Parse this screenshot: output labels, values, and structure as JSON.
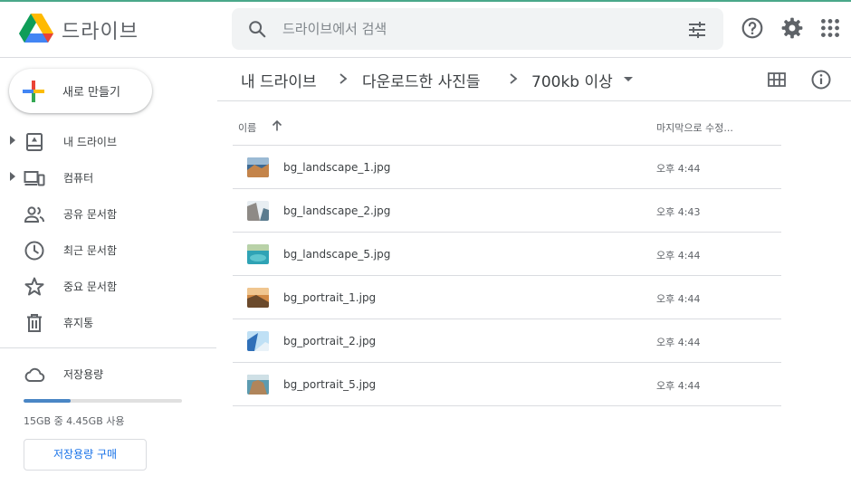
{
  "app": {
    "title": "드라이브"
  },
  "search": {
    "placeholder": "드라이브에서 검색"
  },
  "header_icons": [
    "help-icon",
    "settings-icon",
    "apps-icon"
  ],
  "sidebar": {
    "new_label": "새로 만들기",
    "items": [
      {
        "label": "내 드라이브",
        "icon": "my-drive-icon",
        "expandable": true
      },
      {
        "label": "컴퓨터",
        "icon": "computers-icon",
        "expandable": true
      },
      {
        "label": "공유 문서함",
        "icon": "shared-icon",
        "expandable": false
      },
      {
        "label": "최근 문서함",
        "icon": "recent-icon",
        "expandable": false
      },
      {
        "label": "중요 문서함",
        "icon": "starred-icon",
        "expandable": false
      },
      {
        "label": "휴지통",
        "icon": "trash-icon",
        "expandable": false
      }
    ],
    "storage": {
      "title": "저장용량",
      "usage_text": "15GB 중 4.45GB 사용",
      "used_fraction": 0.297,
      "buy_label": "저장용량 구매"
    }
  },
  "breadcrumb": [
    "내 드라이브",
    "다운로드한 사진들",
    "700kb 이상"
  ],
  "list": {
    "headers": {
      "name": "이름",
      "modified": "마지막으로 수정..."
    },
    "files": [
      {
        "name": "bg_landscape_1.jpg",
        "modified": "오후 4:44"
      },
      {
        "name": "bg_landscape_2.jpg",
        "modified": "오후 4:43"
      },
      {
        "name": "bg_landscape_5.jpg",
        "modified": "오후 4:44"
      },
      {
        "name": "bg_portrait_1.jpg",
        "modified": "오후 4:44"
      },
      {
        "name": "bg_portrait_2.jpg",
        "modified": "오후 4:44"
      },
      {
        "name": "bg_portrait_5.jpg",
        "modified": "오후 4:44"
      }
    ]
  },
  "colors": {
    "accent": "#1a73e8",
    "topline": "#4aa88a",
    "storage_fill": "#4a86c5"
  }
}
